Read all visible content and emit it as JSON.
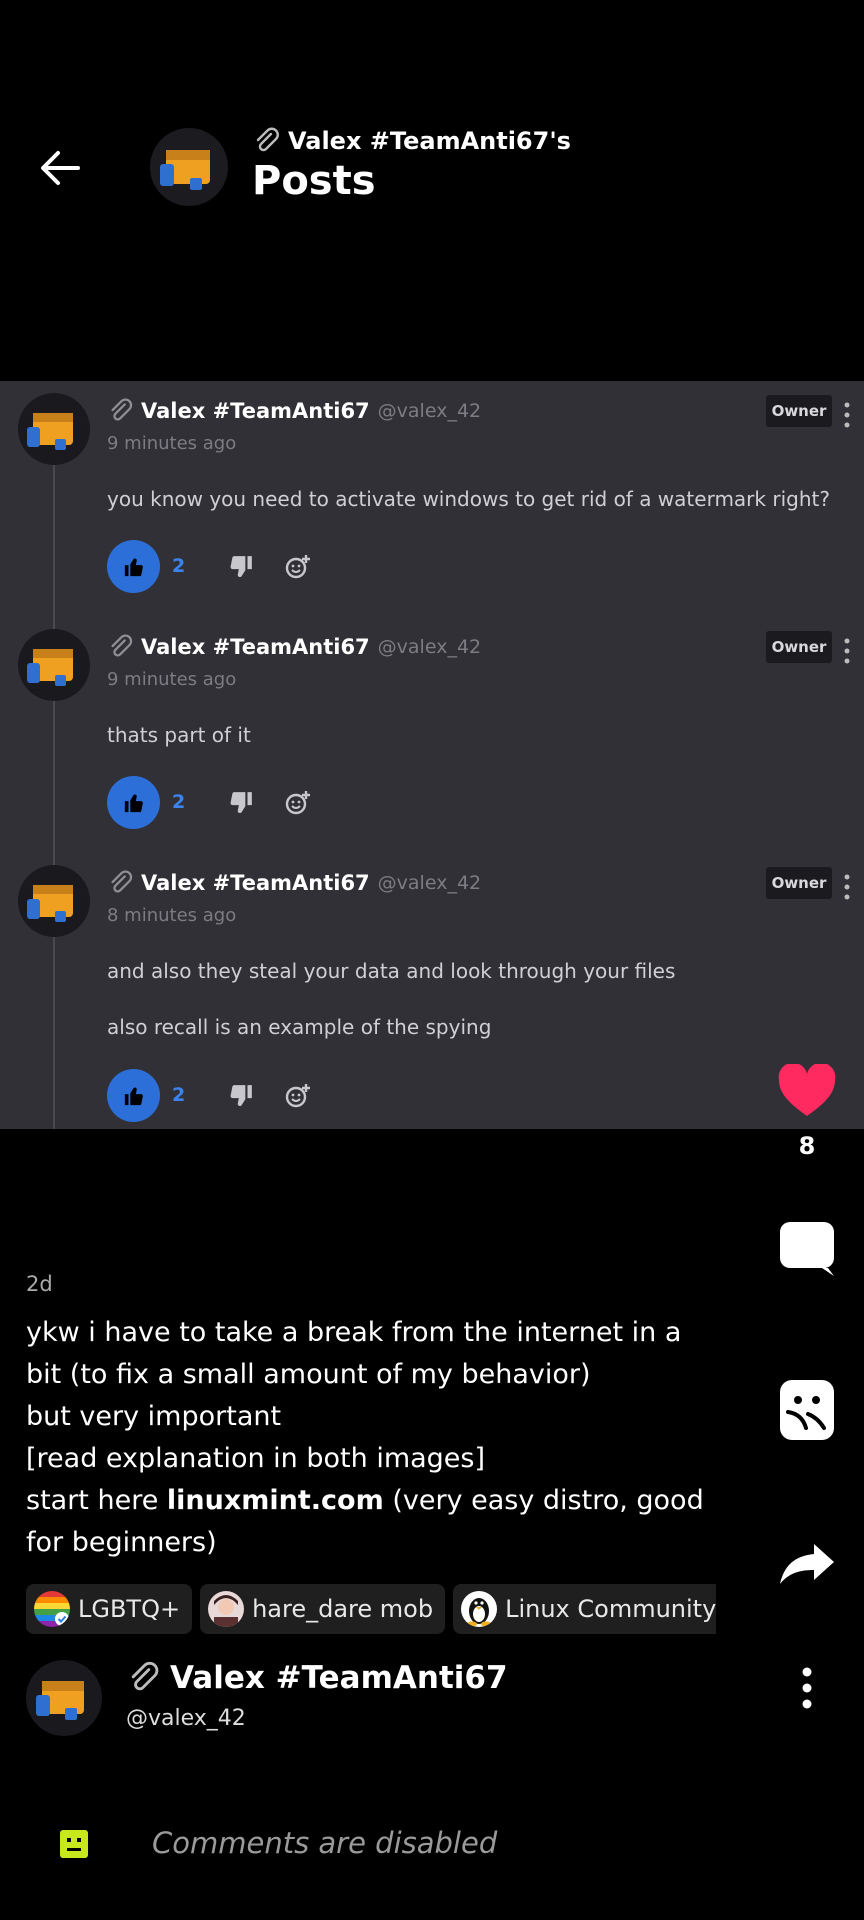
{
  "header": {
    "display_name": "Valex #TeamAnti67's",
    "title": "Posts"
  },
  "screenshot": {
    "comments": [
      {
        "name": "Valex #TeamAnti67",
        "handle": "@valex_42",
        "time": "9 minutes ago",
        "badge": "Owner",
        "lines": [
          "you know you need to activate windows to get rid of a watermark right?"
        ],
        "likes": "2"
      },
      {
        "name": "Valex #TeamAnti67",
        "handle": "@valex_42",
        "time": "9 minutes ago",
        "badge": "Owner",
        "lines": [
          "thats part of it"
        ],
        "likes": "2"
      },
      {
        "name": "Valex #TeamAnti67",
        "handle": "@valex_42",
        "time": "8 minutes ago",
        "badge": "Owner",
        "lines": [
          "and also they steal your data and look through your files",
          "also recall is an example of the spying"
        ],
        "likes": "2"
      }
    ]
  },
  "rail": {
    "like_count": "8",
    "icons": [
      "heart-icon",
      "comment-icon",
      "remix-icon",
      "share-icon"
    ]
  },
  "post": {
    "age": "2d",
    "caption_lines": [
      "ykw i have to take a break from the internet in a",
      "bit (to fix a small amount of my behavior)",
      "but very important",
      "[read explanation in both images]"
    ],
    "caption_link_prefix": "start here ",
    "caption_link": "linuxmint.com",
    "caption_link_suffix": " (very easy distro, good",
    "caption_last": "for beginners)"
  },
  "communities": [
    {
      "label": "LGBTQ+"
    },
    {
      "label": "hare_dare mob"
    },
    {
      "label": "Linux Community"
    }
  ],
  "author": {
    "name": "Valex #TeamAnti67",
    "handle": "@valex_42"
  },
  "comments_bar": {
    "text": "Comments are disabled"
  },
  "colors": {
    "like_blue": "#2c6fd8",
    "heart_pink": "#ff2a5f",
    "screenshot_bg": "#313036",
    "disabled_icon": "#c8e81e"
  }
}
